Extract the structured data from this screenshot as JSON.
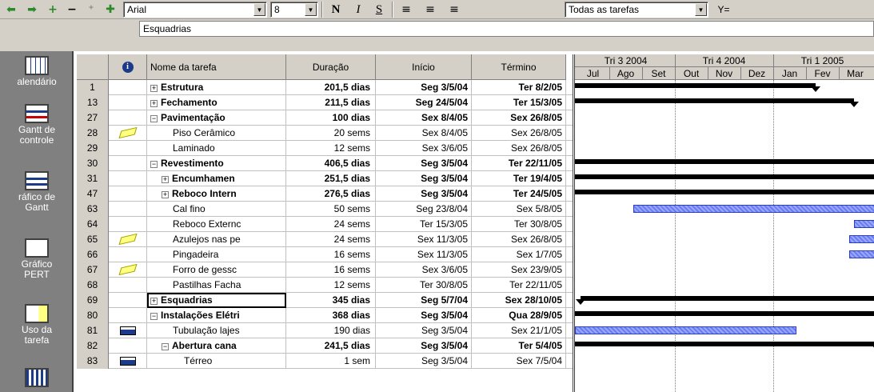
{
  "toolbar": {
    "font": "Arial",
    "size": "8",
    "bold": "N",
    "italic": "I",
    "underline": "S",
    "filter": "Todas as tarefas",
    "filter_icon": "Y="
  },
  "entry": {
    "value": "Esquadrias"
  },
  "views": [
    {
      "label": "alendário",
      "icon": "calendar-icon"
    },
    {
      "label": "Gantt de controle",
      "icon": "tracking-gantt-icon"
    },
    {
      "label": "ráfico de Gantt",
      "icon": "gantt-chart-icon"
    },
    {
      "label": "Gráfico PERT",
      "icon": "pert-chart-icon"
    },
    {
      "label": "Uso da tarefa",
      "icon": "task-usage-icon"
    }
  ],
  "columns": {
    "indicator": "i",
    "name": "Nome da tarefa",
    "duration": "Duração",
    "start": "Início",
    "finish": "Término"
  },
  "tasks": [
    {
      "id": "1",
      "indent": 0,
      "toggle": "+",
      "bold": true,
      "name": "Estrutura",
      "duration": "201,5 dias",
      "start": "Seg 3/5/04",
      "finish": "Ter 8/2/05",
      "indicator": ""
    },
    {
      "id": "13",
      "indent": 0,
      "toggle": "+",
      "bold": true,
      "name": "Fechamento",
      "duration": "211,5 dias",
      "start": "Seg 24/5/04",
      "finish": "Ter 15/3/05",
      "indicator": ""
    },
    {
      "id": "27",
      "indent": 0,
      "toggle": "−",
      "bold": true,
      "name": "Pavimentação",
      "duration": "100 dias",
      "start": "Sex 8/4/05",
      "finish": "Sex 26/8/05",
      "indicator": ""
    },
    {
      "id": "28",
      "indent": 2,
      "toggle": "",
      "bold": false,
      "name": "Piso Cerâmico",
      "duration": "20 sems",
      "start": "Sex 8/4/05",
      "finish": "Sex 26/8/05",
      "indicator": "note"
    },
    {
      "id": "29",
      "indent": 2,
      "toggle": "",
      "bold": false,
      "name": "Laminado",
      "duration": "12 sems",
      "start": "Sex 3/6/05",
      "finish": "Sex 26/8/05",
      "indicator": ""
    },
    {
      "id": "30",
      "indent": 0,
      "toggle": "−",
      "bold": true,
      "name": "Revestimento",
      "duration": "406,5 dias",
      "start": "Seg 3/5/04",
      "finish": "Ter 22/11/05",
      "indicator": ""
    },
    {
      "id": "31",
      "indent": 1,
      "toggle": "+",
      "bold": true,
      "name": "Encumhamen",
      "duration": "251,5 dias",
      "start": "Seg 3/5/04",
      "finish": "Ter 19/4/05",
      "indicator": ""
    },
    {
      "id": "47",
      "indent": 1,
      "toggle": "+",
      "bold": true,
      "name": "Reboco Intern",
      "duration": "276,5 dias",
      "start": "Seg 3/5/04",
      "finish": "Ter 24/5/05",
      "indicator": ""
    },
    {
      "id": "63",
      "indent": 2,
      "toggle": "",
      "bold": false,
      "name": "Cal fino",
      "duration": "50 sems",
      "start": "Seg 23/8/04",
      "finish": "Sex 5/8/05",
      "indicator": ""
    },
    {
      "id": "64",
      "indent": 2,
      "toggle": "",
      "bold": false,
      "name": "Reboco Externc",
      "duration": "24 sems",
      "start": "Ter 15/3/05",
      "finish": "Ter 30/8/05",
      "indicator": ""
    },
    {
      "id": "65",
      "indent": 2,
      "toggle": "",
      "bold": false,
      "name": "Azulejos nas pe",
      "duration": "24 sems",
      "start": "Sex 11/3/05",
      "finish": "Sex 26/8/05",
      "indicator": "note"
    },
    {
      "id": "66",
      "indent": 2,
      "toggle": "",
      "bold": false,
      "name": "Pingadeira",
      "duration": "16 sems",
      "start": "Sex 11/3/05",
      "finish": "Sex 1/7/05",
      "indicator": ""
    },
    {
      "id": "67",
      "indent": 2,
      "toggle": "",
      "bold": false,
      "name": "Forro  de gessc",
      "duration": "16 sems",
      "start": "Sex 3/6/05",
      "finish": "Sex 23/9/05",
      "indicator": "note"
    },
    {
      "id": "68",
      "indent": 2,
      "toggle": "",
      "bold": false,
      "name": "Pastilhas Facha",
      "duration": "12 sems",
      "start": "Ter 30/8/05",
      "finish": "Ter 22/11/05",
      "indicator": ""
    },
    {
      "id": "69",
      "indent": 0,
      "toggle": "+",
      "bold": true,
      "name": "Esquadrias",
      "duration": "345 dias",
      "start": "Seg 5/7/04",
      "finish": "Sex 28/10/05",
      "indicator": "",
      "selected": true
    },
    {
      "id": "80",
      "indent": 0,
      "toggle": "−",
      "bold": true,
      "name": "Instalações Elétri",
      "duration": "368 dias",
      "start": "Seg 3/5/04",
      "finish": "Qua 28/9/05",
      "indicator": ""
    },
    {
      "id": "81",
      "indent": 2,
      "toggle": "",
      "bold": false,
      "name": "Tubulação lajes",
      "duration": "190 dias",
      "start": "Seg 3/5/04",
      "finish": "Sex 21/1/05",
      "indicator": "calendar"
    },
    {
      "id": "82",
      "indent": 1,
      "toggle": "−",
      "bold": true,
      "name": "Abertura cana",
      "duration": "241,5 dias",
      "start": "Seg 3/5/04",
      "finish": "Ter 5/4/05",
      "indicator": ""
    },
    {
      "id": "83",
      "indent": 3,
      "toggle": "",
      "bold": false,
      "name": "Térreo",
      "duration": "1 sem",
      "start": "Seg 3/5/04",
      "finish": "Sex 7/5/04",
      "indicator": "calendar"
    }
  ],
  "timescale": {
    "quarters": [
      "Tri 3 2004",
      "Tri 4 2004",
      "Tri 1 2005"
    ],
    "months": [
      "Jul",
      "Ago",
      "Set",
      "Out",
      "Nov",
      "Dez",
      "Jan",
      "Fev",
      "Mar"
    ]
  }
}
